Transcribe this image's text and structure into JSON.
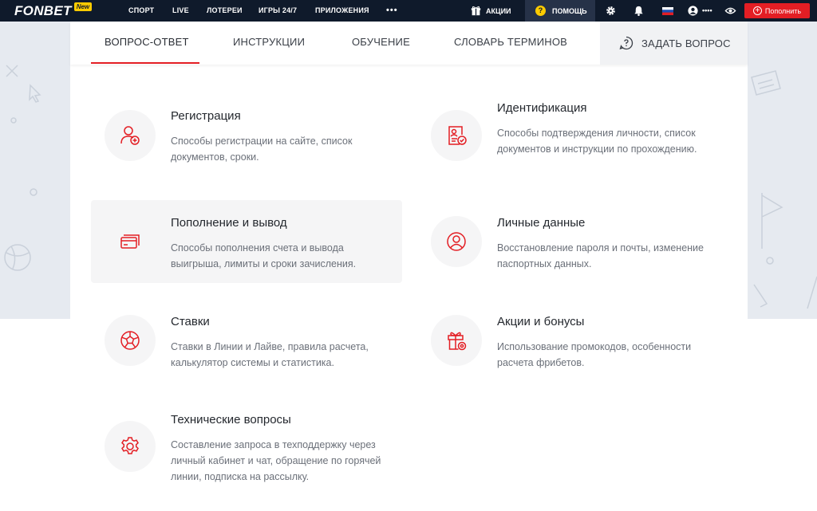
{
  "brand": {
    "name": "FONBET",
    "badge": "New"
  },
  "topnav": {
    "items": [
      "СПОРТ",
      "LIVE",
      "ЛОТЕРЕИ",
      "ИГРЫ 24/7",
      "ПРИЛОЖЕНИЯ"
    ],
    "more": "•••",
    "promo": "АКЦИИ",
    "help": "ПОМОЩЬ",
    "balance_masked": "••••",
    "deposit": "Пополнить"
  },
  "tabs": {
    "items": [
      "ВОПРОС-ОТВЕТ",
      "ИНСТРУКЦИИ",
      "ОБУЧЕНИЕ",
      "СЛОВАРЬ ТЕРМИНОВ"
    ],
    "active": "ВОПРОС-ОТВЕТ",
    "ask": "ЗАДАТЬ ВОПРОС"
  },
  "categories": [
    {
      "title": "Регистрация",
      "desc": "Способы регистрации на сайте, список документов, сроки.",
      "icon": "user-plus-icon"
    },
    {
      "title": "Идентификация",
      "desc": "Способы подтверждения личности, список документов и инструкции по прохождению.",
      "icon": "id-check-icon"
    },
    {
      "title": "Пополнение и вывод",
      "desc": "Способы пополнения счета и вывода выигрыша, лимиты и сроки зачисления.",
      "icon": "cards-icon"
    },
    {
      "title": "Личные данные",
      "desc": "Восстановление пароля и почты, изменение паспортных данных.",
      "icon": "user-circle-icon"
    },
    {
      "title": "Ставки",
      "desc": "Ставки в Линии и Лайве, правила расчета, калькулятор системы и статистика.",
      "icon": "soccer-ball-icon"
    },
    {
      "title": "Акции и бонусы",
      "desc": "Использование промокодов, особенности расчета фрибетов.",
      "icon": "gift-icon"
    },
    {
      "title": "Технические вопросы",
      "desc": "Составление запроса в техподдержку через личный кабинет и чат, обращение по горячей линии, подписка на рассылку.",
      "icon": "gear-icon"
    }
  ],
  "colors": {
    "accent": "#e31e24",
    "topbar": "#0f1a2b",
    "help_badge": "#ffcc00"
  }
}
